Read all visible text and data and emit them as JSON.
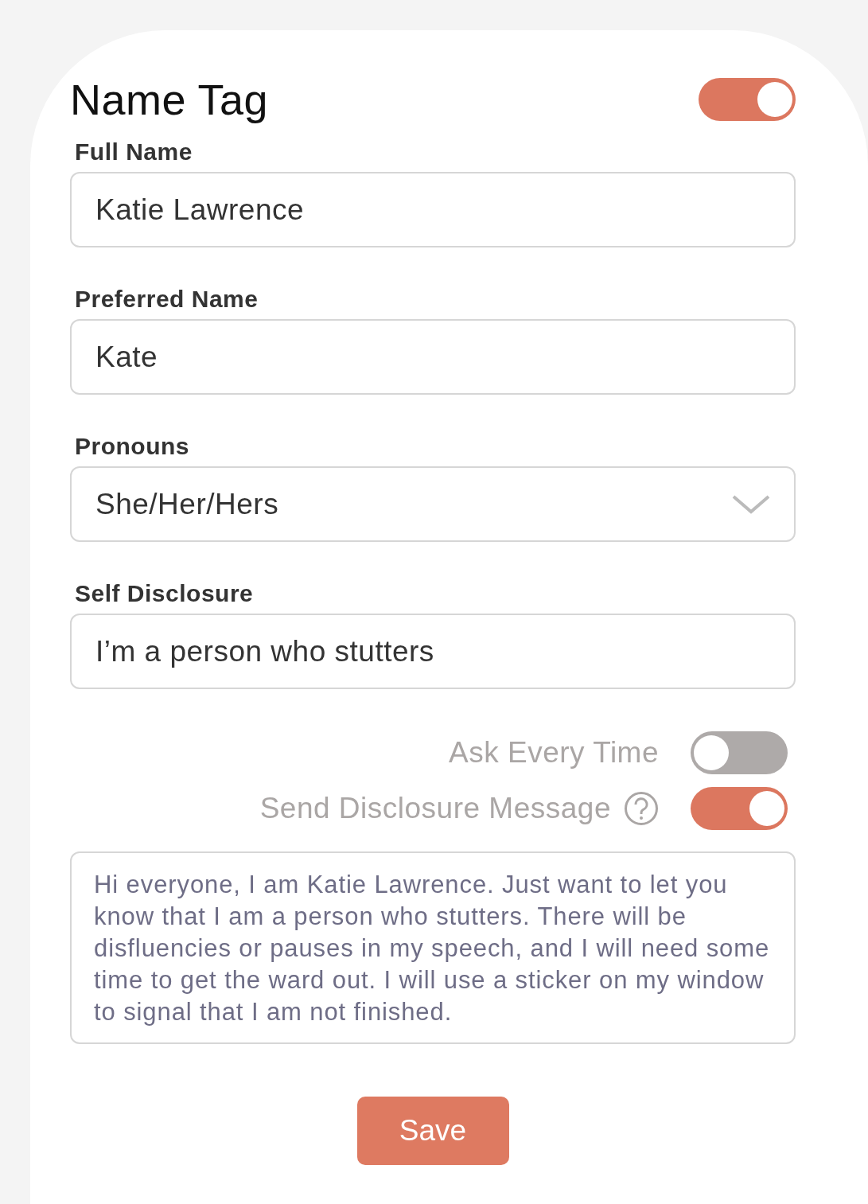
{
  "title": "Name Tag",
  "name_tag_toggle": {
    "on": true
  },
  "fields": [
    {
      "kind": "text",
      "label": "Full Name",
      "value": "Katie Lawrence"
    },
    {
      "kind": "text",
      "label": "Preferred Name",
      "value": "Kate"
    },
    {
      "kind": "select",
      "label": "Pronouns",
      "value": "She/Her/Hers"
    },
    {
      "kind": "text",
      "label": "Self Disclosure",
      "value": "I’m a person who stutters"
    }
  ],
  "options": [
    {
      "label": "Ask Every Time",
      "help": false,
      "on": false
    },
    {
      "label": "Send Disclosure Message",
      "help": true,
      "on": true
    }
  ],
  "message": "Hi everyone, I am Katie Lawrence. Just want to let you know that I am a person who stutters. There will be disfluencies or pauses in my speech, and I will need some time to get the ward out. I will use a sticker on my window to signal that I am not finished.",
  "save_button": "Save"
}
